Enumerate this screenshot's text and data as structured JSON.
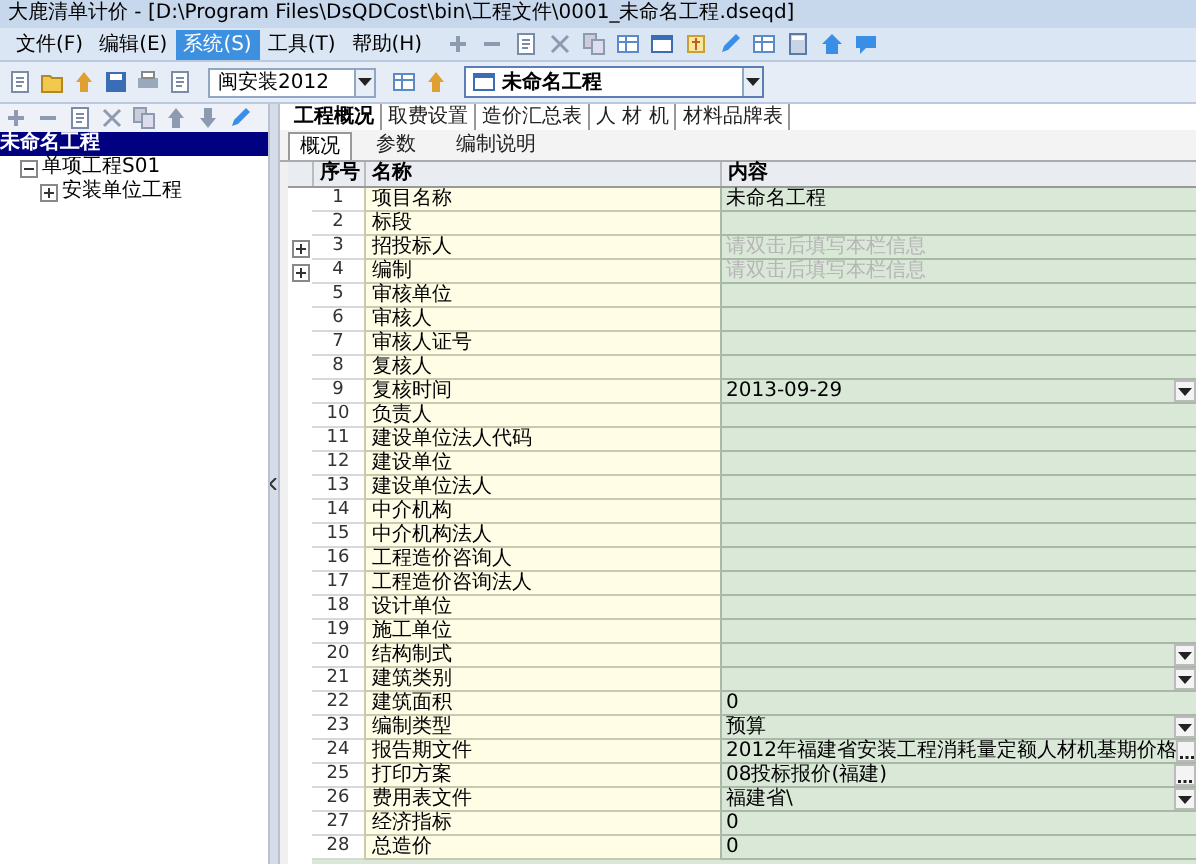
{
  "window": {
    "title": "大鹿清单计价 - [D:\\Program Files\\DsQDCost\\bin\\工程文件\\0001_未命名工程.dseqd]"
  },
  "menu": [
    {
      "label": "文件(F)",
      "selected": false
    },
    {
      "label": "编辑(E)",
      "selected": false
    },
    {
      "label": "系统(S)",
      "selected": true
    },
    {
      "label": "工具(T)",
      "selected": false
    },
    {
      "label": "帮助(H)",
      "selected": false
    }
  ],
  "toolbar": {
    "quota_combo": {
      "value": "闽安装2012"
    },
    "project_combo": {
      "value": "未命名工程"
    }
  },
  "tree": [
    {
      "label": "未命名工程",
      "selected": true,
      "children": [
        {
          "label": "单项工程S01",
          "selected": false,
          "expanded": true,
          "children": [
            {
              "label": "安装单位工程",
              "selected": false,
              "expanded": false
            }
          ]
        }
      ]
    }
  ],
  "tabs": [
    {
      "label": "工程概况",
      "selected": true
    },
    {
      "label": "取费设置",
      "selected": false
    },
    {
      "label": "造价汇总表",
      "selected": false
    },
    {
      "label": "人 材 机",
      "selected": false
    },
    {
      "label": "材料品牌表",
      "selected": false
    }
  ],
  "subtabs": [
    {
      "label": "概况",
      "selected": true
    },
    {
      "label": "参数",
      "selected": false
    },
    {
      "label": "编制说明",
      "selected": false
    }
  ],
  "table": {
    "columns": [
      "序号",
      "名称",
      "内容"
    ],
    "rows": [
      {
        "no": "1",
        "name": "项目名称",
        "value": "未命名工程"
      },
      {
        "no": "2",
        "name": "标段"
      },
      {
        "no": "3",
        "name": "招投标人",
        "placeholder": "请双击后填写本栏信息",
        "expanded": false
      },
      {
        "no": "4",
        "name": "编制",
        "placeholder": "请双击后填写本栏信息",
        "expanded": false
      },
      {
        "no": "5",
        "name": "审核单位"
      },
      {
        "no": "6",
        "name": "审核人"
      },
      {
        "no": "7",
        "name": "审核人证号"
      },
      {
        "no": "8",
        "name": "复核人"
      },
      {
        "no": "9",
        "name": "复核时间",
        "value": "2013-09-29",
        "kind": "dropdown"
      },
      {
        "no": "10",
        "name": "负责人"
      },
      {
        "no": "11",
        "name": "建设单位法人代码"
      },
      {
        "no": "12",
        "name": "建设单位"
      },
      {
        "no": "13",
        "name": "建设单位法人"
      },
      {
        "no": "14",
        "name": "中介机构"
      },
      {
        "no": "15",
        "name": "中介机构法人"
      },
      {
        "no": "16",
        "name": "工程造价咨询人"
      },
      {
        "no": "17",
        "name": "工程造价咨询法人"
      },
      {
        "no": "18",
        "name": "设计单位"
      },
      {
        "no": "19",
        "name": "施工单位"
      },
      {
        "no": "20",
        "name": "结构制式",
        "kind": "dropdown"
      },
      {
        "no": "21",
        "name": "建筑类别",
        "kind": "dropdown"
      },
      {
        "no": "22",
        "name": "建筑面积",
        "value": "0"
      },
      {
        "no": "23",
        "name": "编制类型",
        "value": "预算",
        "kind": "dropdown"
      },
      {
        "no": "24",
        "name": "报告期文件",
        "value": "2012年福建省安装工程消耗量定额人材机基期价格",
        "kind": "ellipsis"
      },
      {
        "no": "25",
        "name": "打印方案",
        "value": "08投标报价(福建)",
        "kind": "ellipsis"
      },
      {
        "no": "26",
        "name": "费用表文件",
        "value": "福建省\\",
        "kind": "dropdown"
      },
      {
        "no": "27",
        "name": "经济指标",
        "value": "0"
      },
      {
        "no": "28",
        "name": "总造价",
        "value": "0"
      }
    ]
  }
}
